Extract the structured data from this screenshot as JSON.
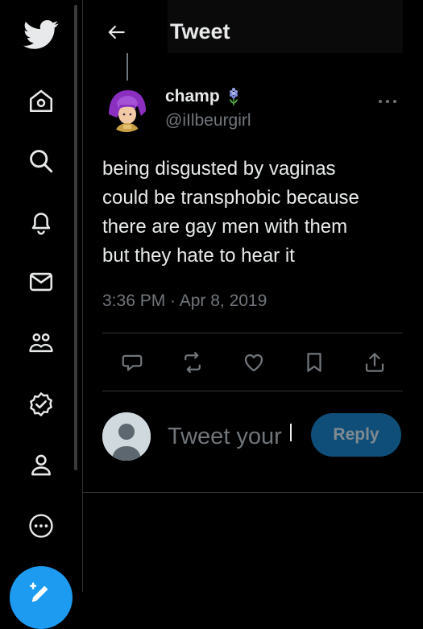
{
  "header": {
    "title": "Tweet"
  },
  "sidebar": {
    "items": [
      {
        "icon": "twitter-bird-icon"
      },
      {
        "icon": "home-icon"
      },
      {
        "icon": "search-icon"
      },
      {
        "icon": "notifications-bell-icon"
      },
      {
        "icon": "messages-envelope-icon"
      },
      {
        "icon": "communities-icon"
      },
      {
        "icon": "verified-badge-icon"
      },
      {
        "icon": "profile-icon"
      },
      {
        "icon": "more-circle-icon"
      },
      {
        "icon": "compose-tweet-icon"
      }
    ]
  },
  "tweet": {
    "display_name": "champ",
    "name_emoji": "hyacinth-flower-icon",
    "handle": "@iIlbeurgirl",
    "text": "being disgusted by vaginas\ncould be transphobic because\nthere are gay men with them\nbut they hate to hear it",
    "timestamp": "3:36 PM · Apr 8, 2019"
  },
  "reply": {
    "placeholder": "Tweet your",
    "button_label": "Reply"
  },
  "colors": {
    "background": "#000000",
    "text": "#e7e9ea",
    "muted": "#71767b",
    "accent": "#1d9bf0",
    "reply_button_disabled": "#0f4e78"
  }
}
